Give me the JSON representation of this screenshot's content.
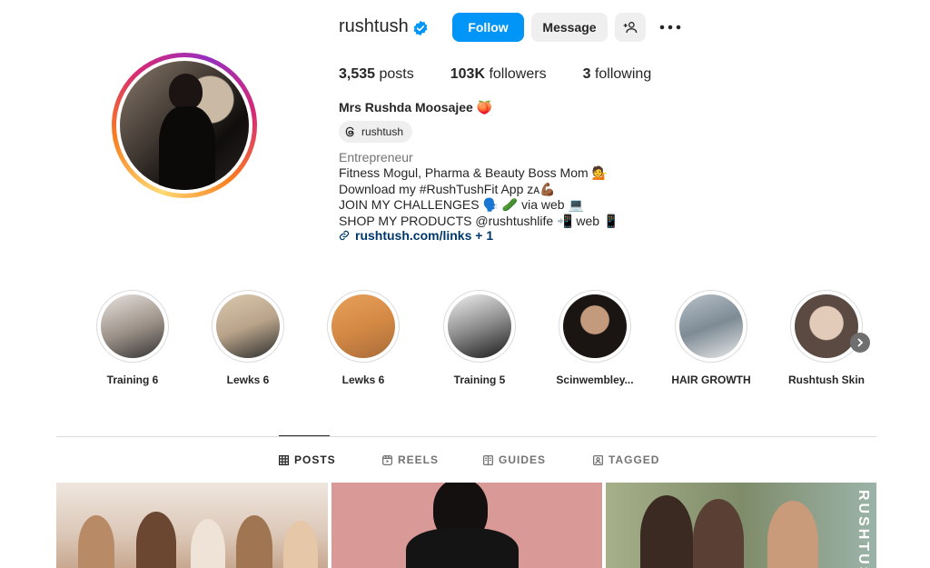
{
  "profile": {
    "username": "rushtush",
    "follow_label": "Follow",
    "message_label": "Message",
    "posts_count": "3,535",
    "posts_label": "posts",
    "followers_count": "103K",
    "followers_label": "followers",
    "following_count": "3",
    "following_label": "following",
    "full_name": "Mrs Rushda Moosajee 🍑",
    "threads_handle": "rushtush",
    "category": "Entrepreneur",
    "bio_lines": [
      "Fitness Mogul, Pharma & Beauty Boss Mom 💁",
      "Download my #RushTushFit App ᴢᴀ💪🏾",
      "JOIN MY CHALLENGES 🗣️ 🥒 via web 💻",
      "SHOP MY PRODUCTS @rushtushlife 📲 web 📱"
    ],
    "link_text": "rushtush.com/links + 1"
  },
  "highlights": [
    {
      "label": "Training 6",
      "color": "#9a8f86"
    },
    {
      "label": "Lewks 6",
      "color": "#b9a48a"
    },
    {
      "label": "Lewks 6",
      "color": "#d58a44"
    },
    {
      "label": "Training 5",
      "color": "#8d8d8d"
    },
    {
      "label": "Scinwembley...",
      "color": "#6b5a4c"
    },
    {
      "label": "HAIR GROWTH",
      "color": "#7d8b95"
    },
    {
      "label": "Rushtush Skin",
      "color": "#d9c6b8"
    }
  ],
  "tabs": [
    {
      "label": "POSTS",
      "icon": "grid-icon",
      "active": true
    },
    {
      "label": "REELS",
      "icon": "reels-icon",
      "active": false
    },
    {
      "label": "GUIDES",
      "icon": "guides-icon",
      "active": false
    },
    {
      "label": "TAGGED",
      "icon": "tagged-icon",
      "active": false
    }
  ],
  "posts": [
    {
      "overlay_text": ""
    },
    {
      "overlay_text": ""
    },
    {
      "overlay_text": "RUSHTUS"
    }
  ],
  "colors": {
    "accent": "#0095f6",
    "verified": "#0095f6",
    "link": "#00376b"
  }
}
